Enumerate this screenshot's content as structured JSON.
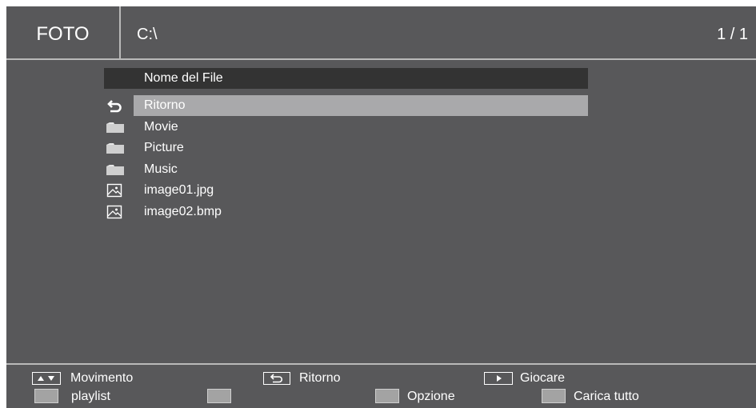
{
  "header": {
    "title": "FOTO",
    "path": "C:\\",
    "page": "1 / 1"
  },
  "file_list": {
    "column_header": "Nome del File",
    "items": [
      {
        "name": "Ritorno",
        "icon": "return-icon",
        "selected": true
      },
      {
        "name": "Movie",
        "icon": "folder-icon"
      },
      {
        "name": "Picture",
        "icon": "folder-icon"
      },
      {
        "name": "Music",
        "icon": "folder-icon"
      },
      {
        "name": "image01.jpg",
        "icon": "image-file-icon"
      },
      {
        "name": "image02.bmp",
        "icon": "image-file-icon"
      }
    ]
  },
  "footer": {
    "move_label": "Movimento",
    "return_label": "Ritorno",
    "play_label": "Giocare",
    "playlist_label": "playlist",
    "option_label": "Opzione",
    "load_all_label": "Carica tutto"
  },
  "colors": {
    "background": "#58585a",
    "selection": "#a9a9ab",
    "column_header_bg": "#333333",
    "divider": "#b9b9b9"
  }
}
